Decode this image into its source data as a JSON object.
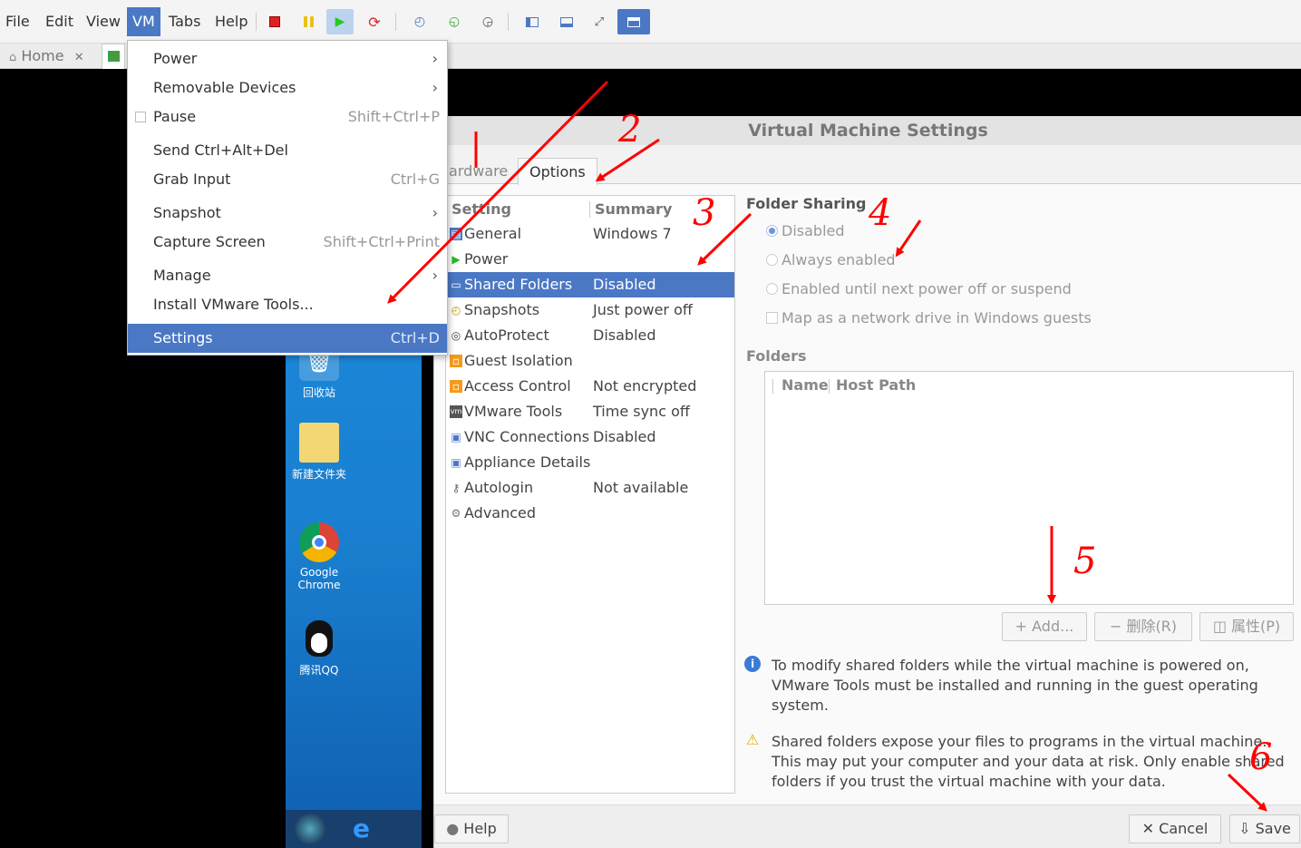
{
  "menubar": {
    "items": [
      "File",
      "Edit",
      "View",
      "VM",
      "Tabs",
      "Help"
    ],
    "active": "VM"
  },
  "toolbar": {
    "icons": [
      "power-off-icon",
      "suspend-icon",
      "play-icon",
      "restart-icon",
      "snapshot-icon",
      "revert-snapshot-icon",
      "snapshot-manager-icon",
      "sidebar-icon",
      "console-view-icon",
      "fullscreen-icon",
      "unity-icon"
    ]
  },
  "tabs": {
    "home": "Home",
    "close": "✕"
  },
  "vm_menu": {
    "items": [
      {
        "label": "Power",
        "shortcut": "",
        "submenu": true
      },
      {
        "label": "Removable Devices",
        "shortcut": "",
        "submenu": true
      },
      {
        "label": "Pause",
        "shortcut": "Shift+Ctrl+P",
        "submenu": false,
        "check": true
      },
      {
        "label": "Send Ctrl+Alt+Del",
        "shortcut": "",
        "submenu": false
      },
      {
        "label": "Grab Input",
        "shortcut": "Ctrl+G",
        "submenu": false
      },
      {
        "label": "Snapshot",
        "shortcut": "",
        "submenu": true
      },
      {
        "label": "Capture Screen",
        "shortcut": "Shift+Ctrl+Print",
        "submenu": false
      },
      {
        "label": "Manage",
        "shortcut": "",
        "submenu": true
      },
      {
        "label": "Install VMware Tools...",
        "shortcut": "",
        "submenu": false
      },
      {
        "label": "Settings",
        "shortcut": "Ctrl+D",
        "submenu": false,
        "selected": true
      }
    ]
  },
  "desktop": {
    "icons": [
      {
        "label": "回收站"
      },
      {
        "label": "新建文件夹"
      },
      {
        "label": "Google\nChrome"
      },
      {
        "label": "腾讯QQ"
      }
    ]
  },
  "dialog": {
    "title": "Virtual Machine Settings",
    "tabs": {
      "hardware": "Hardware",
      "options": "Options"
    },
    "list_headers": {
      "setting": "Setting",
      "summary": "Summary"
    },
    "settings": [
      {
        "name": "General",
        "summary": "Windows 7",
        "icon": "general-icon"
      },
      {
        "name": "Power",
        "summary": "",
        "icon": "power-icon"
      },
      {
        "name": "Shared Folders",
        "summary": "Disabled",
        "icon": "folder-icon",
        "selected": true
      },
      {
        "name": "Snapshots",
        "summary": "Just power off",
        "icon": "snapshot-icon"
      },
      {
        "name": "AutoProtect",
        "summary": "Disabled",
        "icon": "autoprotect-icon"
      },
      {
        "name": "Guest Isolation",
        "summary": "",
        "icon": "guest-isolation-icon"
      },
      {
        "name": "Access Control",
        "summary": "Not encrypted",
        "icon": "access-control-icon"
      },
      {
        "name": "VMware Tools",
        "summary": "Time sync off",
        "icon": "vmware-tools-icon"
      },
      {
        "name": "VNC Connections",
        "summary": "Disabled",
        "icon": "vnc-icon"
      },
      {
        "name": "Appliance Details",
        "summary": "",
        "icon": "appliance-icon"
      },
      {
        "name": "Autologin",
        "summary": "Not available",
        "icon": "key-icon"
      },
      {
        "name": "Advanced",
        "summary": "",
        "icon": "advanced-icon"
      }
    ],
    "folder_sharing": {
      "title": "Folder Sharing",
      "options": [
        "Disabled",
        "Always enabled",
        "Enabled until next power off or suspend"
      ],
      "selected": "Disabled",
      "map_drive": "Map as a network drive in Windows guests"
    },
    "folders": {
      "title": "Folders",
      "columns": [
        "Name",
        "Host Path"
      ],
      "buttons": {
        "add": "Add...",
        "remove": "删除(R)",
        "properties": "属性(P)"
      }
    },
    "info_note": "To modify shared folders while the virtual machine is powered on, VMware Tools must be installed and running in the guest operating system.",
    "warning_note": "Shared folders expose your files to programs in the virtual machine. This may put your computer and your data at risk. Only enable shared folders if you trust the virtual machine with your data.",
    "footer": {
      "help": "Help",
      "cancel": "Cancel",
      "save": "Save"
    }
  },
  "annotations": [
    "1",
    "2",
    "3",
    "4",
    "5",
    "6"
  ],
  "colors": {
    "accent": "#4a78c4",
    "annotation": "#ff0000"
  }
}
